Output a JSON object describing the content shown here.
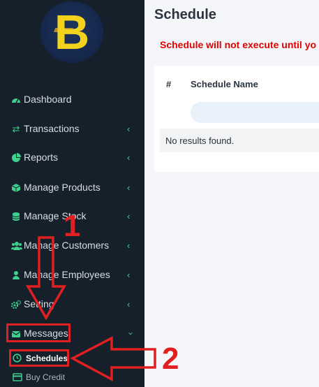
{
  "sidebar": {
    "items": [
      {
        "label": "Dashboard",
        "icon": "dashboard-icon",
        "chevron": false
      },
      {
        "label": "Transactions",
        "icon": "transactions-icon",
        "chevron": true
      },
      {
        "label": "Reports",
        "icon": "reports-icon",
        "chevron": true
      },
      {
        "label": "Manage Products",
        "icon": "products-icon",
        "chevron": true
      },
      {
        "label": "Manage Stock",
        "icon": "stock-icon",
        "chevron": true
      },
      {
        "label": "Manage Customers",
        "icon": "customers-icon",
        "chevron": true
      },
      {
        "label": "Manage Employees",
        "icon": "employees-icon",
        "chevron": true
      },
      {
        "label": "Setting",
        "icon": "settings-icon",
        "chevron": true
      },
      {
        "label": "Messages",
        "icon": "envelope-icon",
        "chevron": true,
        "expanded": true
      }
    ],
    "sub_items": [
      {
        "label": "Schedules",
        "icon": "clock-icon"
      },
      {
        "label": "Buy Credit",
        "icon": "credit-card-icon"
      }
    ]
  },
  "main": {
    "title": "Schedule",
    "warning": "Schedule will not execute until yo",
    "table": {
      "headers": [
        "#",
        "Schedule Name"
      ],
      "empty_text": "No results found."
    }
  },
  "annotations": {
    "step1": "1",
    "step2": "2",
    "color": "#e02020"
  },
  "colors": {
    "sidebar_bg": "#16202b",
    "accent_green": "#3fcf8e",
    "warning_red": "#e00000",
    "logo_yellow": "#f2d21c"
  }
}
